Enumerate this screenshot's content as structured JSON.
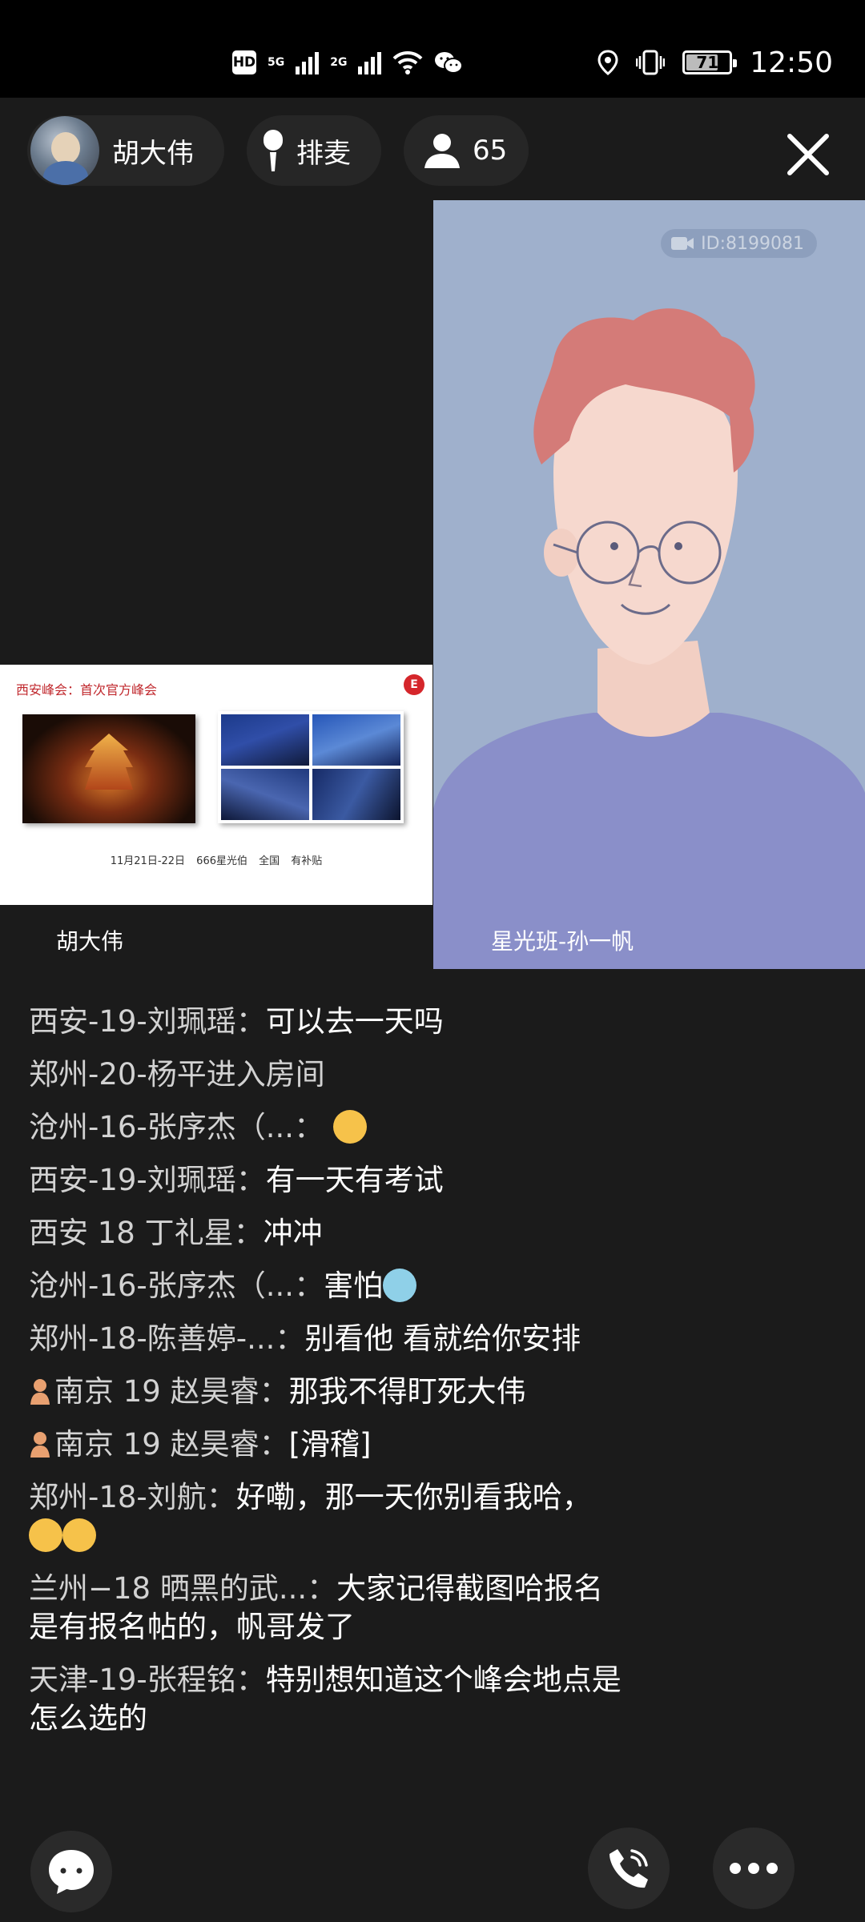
{
  "status_bar": {
    "hd_label": "HD",
    "network_5g": "5G",
    "network_2g": "2G",
    "battery": "71",
    "time": "12:50",
    "icons": [
      "hd-icon",
      "signal-icon",
      "wifi-icon",
      "wechat-icon",
      "location-icon",
      "vibrate-icon",
      "battery-icon"
    ]
  },
  "topbar": {
    "host_name": "胡大伟",
    "queue_label": "排麦",
    "viewer_count": "65"
  },
  "video": {
    "left_name": "胡大伟",
    "right_name": "星光班-孙一帆",
    "room_id": "ID:8199081",
    "slide": {
      "title": "西安峰会：首次官方峰会",
      "logo": "E",
      "caption": "11月21日-22日   666星光伯   全国   有补贴"
    },
    "background_color": "#9fb0cc"
  },
  "chat": {
    "messages": [
      {
        "user": "西安-19-刘珮瑶：",
        "text": "可以去一天吗"
      },
      {
        "user": "郑州-20-杨平进入房间",
        "text": ""
      },
      {
        "user": "沧州-16-张序杰（...：",
        "text": "",
        "emoji": "blush"
      },
      {
        "user": "西安-19-刘珮瑶：",
        "text": "有一天有考试"
      },
      {
        "user": "西安 18 丁礼星：",
        "text": "冲冲"
      },
      {
        "user": "沧州-16-张序杰（...：",
        "text": "害怕",
        "emoji": "scream"
      },
      {
        "user": "郑州-18-陈善婷-...：",
        "text": "别看他 看就给你安排"
      },
      {
        "user": "南京 19 赵昊睿：",
        "text": "那我不得盯死大伟"
      },
      {
        "user": "南京 19 赵昊睿：",
        "text": "[滑稽]"
      },
      {
        "user": "郑州-18-刘航：",
        "text": "好嘞，那一天你别看我哈，"
      },
      {
        "user": "兰州−18 晒黑的武...：",
        "text": "大家记得截图哈报名是有报名帖的，帆哥发了"
      },
      {
        "user": "天津-19-张程铭：",
        "text": "特别想知道这个峰会地点是怎么选的"
      }
    ]
  },
  "bottom": {
    "buttons": [
      "chat-bubble-icon",
      "phone-icon",
      "more-icon"
    ]
  }
}
